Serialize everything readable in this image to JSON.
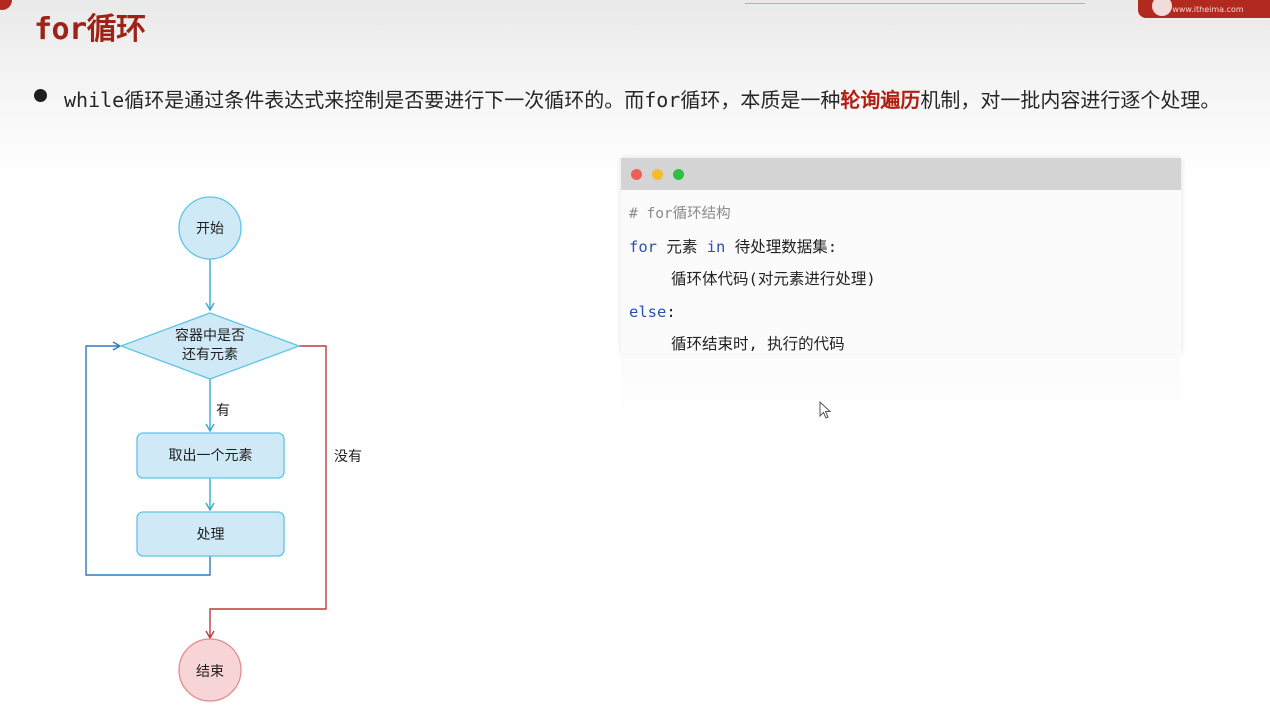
{
  "slide": {
    "title": "for循环",
    "bullet": {
      "part1": "while",
      "part2": "循环是通过条件表达式来控制是否要进行下一次循环的。而",
      "part3": "for",
      "part4": "循环，本质是一种",
      "highlight": "轮询遍历",
      "part5": "机制，对一批内容进行逐个处理。"
    }
  },
  "code_window": {
    "comment": "# for循环结构",
    "line1_kw_for": "for",
    "line1_var": "元素",
    "line1_kw_in": "in",
    "line1_rest": "待处理数据集:",
    "line2": "循环体代码(对元素进行处理)",
    "line3_kw_else": "else",
    "line3_colon": ":",
    "line4": "循环结束时, 执行的代码",
    "dot_colors": [
      "#ee5f57",
      "#f5bc2f",
      "#2cc140"
    ]
  },
  "flowchart": {
    "start": "开始",
    "decision_line1": "容器中是否",
    "decision_line2": "还有元素",
    "yes_label": "有",
    "no_label": "没有",
    "step1": "取出一个元素",
    "step2": "处理",
    "end": "结束",
    "colors": {
      "node_fill": "#cfeaf6",
      "node_stroke": "#5ec4e6",
      "flow_line": "#3aa9cf",
      "loop_line": "#2f7bbf",
      "exit_line": "#c0393b",
      "end_fill": "#f7d4d5",
      "end_stroke": "#e58a8d"
    }
  },
  "logo": {
    "text": "www.itheima.com"
  }
}
